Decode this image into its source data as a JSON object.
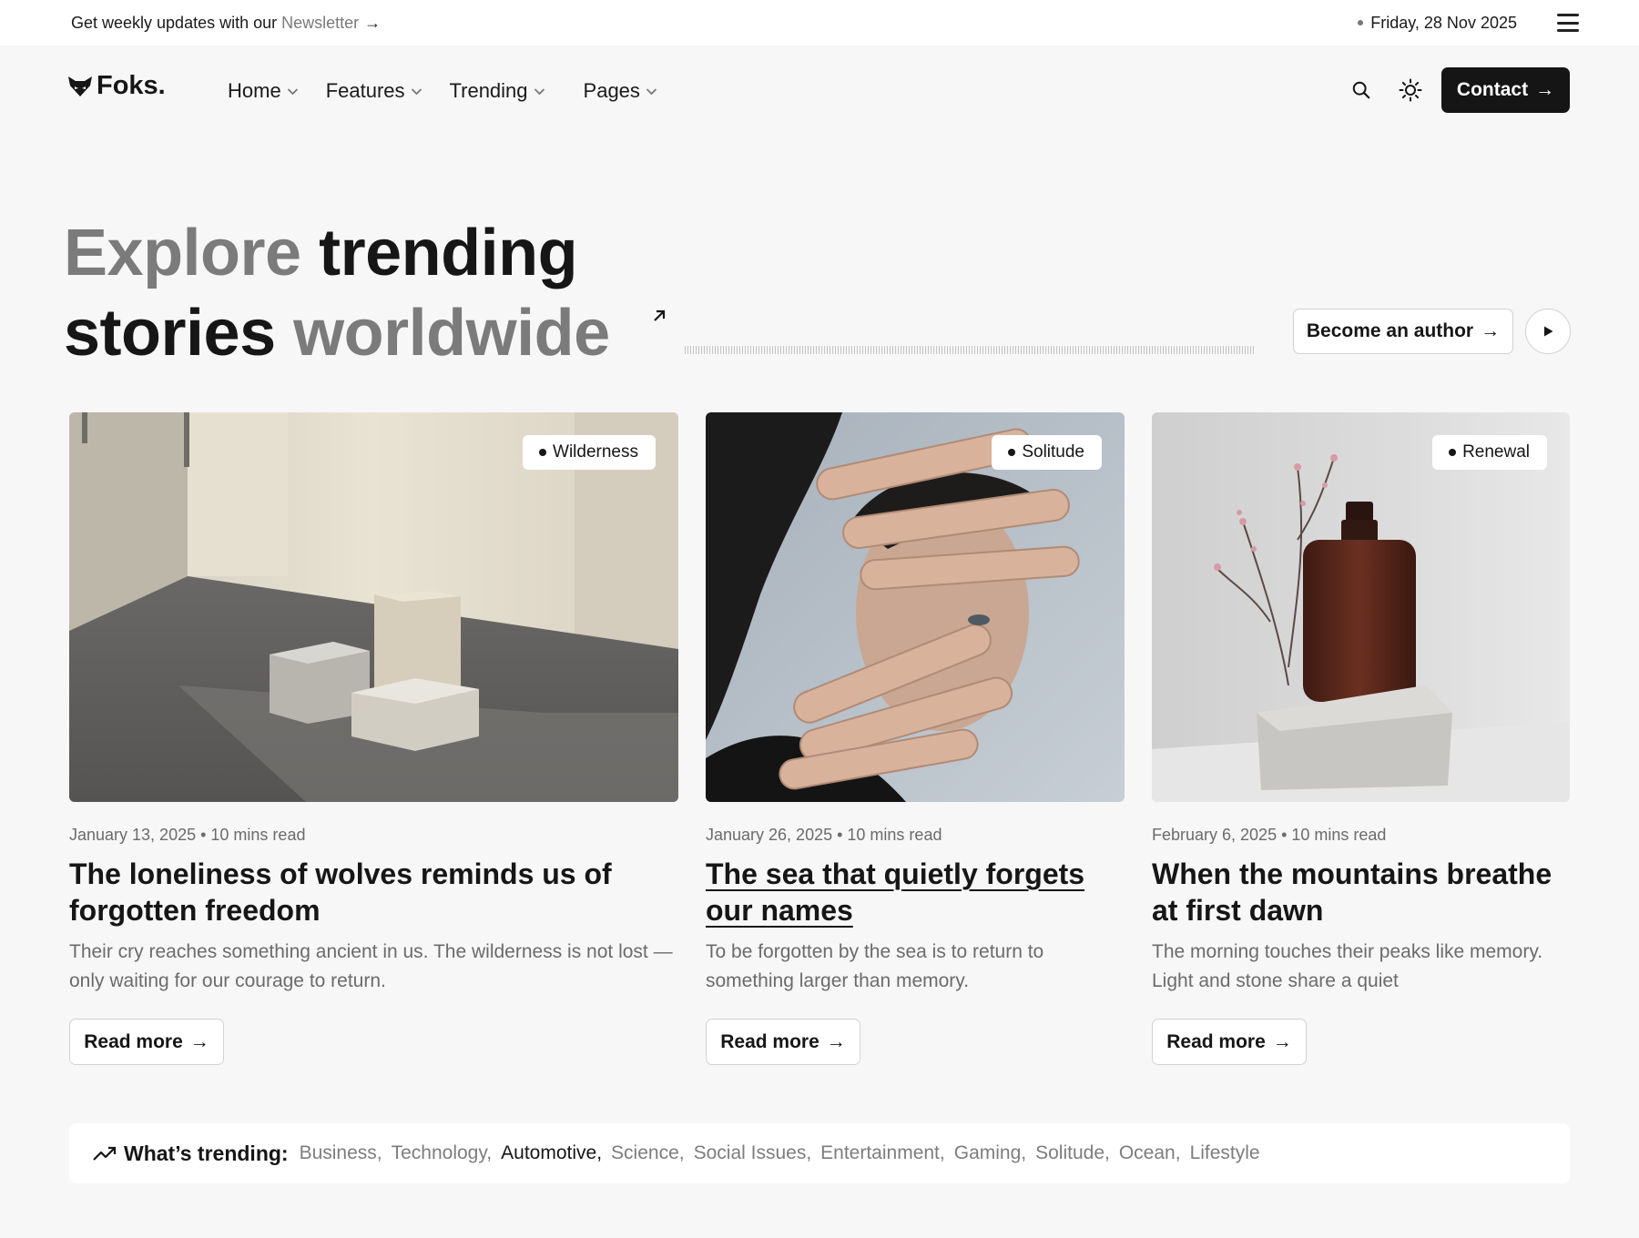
{
  "topbar": {
    "promo_text": "Get weekly updates with our",
    "newsletter_link": "Newsletter",
    "promo_arrow": "→",
    "date": "Friday, 28 Nov 2025"
  },
  "header": {
    "logo_text": "Foks.",
    "nav": [
      {
        "label": "Home"
      },
      {
        "label": "Features"
      },
      {
        "label": "Trending"
      },
      {
        "label": "Pages"
      }
    ],
    "contact_label": "Contact",
    "contact_arrow": "→"
  },
  "hero": {
    "line1_light": "Explore",
    "line1_dark": "trending",
    "line2_dark": "stories",
    "line2_light": "worldwide",
    "author_button": "Become an author",
    "author_arrow": "→"
  },
  "cards": [
    {
      "tag": "Wilderness",
      "meta": "January 13, 2025 • 10 mins read",
      "title": "The loneliness of wolves reminds us of forgotten freedom",
      "excerpt": "Their cry reaches something ancient in us. The wilderness is not lost — only waiting for our courage to return.",
      "button": "Read more",
      "arrow": "→"
    },
    {
      "tag": "Solitude",
      "meta": "January 26, 2025 • 10 mins read",
      "title": "The sea that quietly forgets our names",
      "excerpt": "To be forgotten by the sea is to return to something larger than memory.",
      "button": "Read more",
      "arrow": "→"
    },
    {
      "tag": "Renewal",
      "meta": "February 6, 2025 • 10 mins read",
      "title": "When the mountains breathe at first dawn",
      "excerpt": "The morning touches their peaks like memory. Light and stone share a quiet",
      "button": "Read more",
      "arrow": "→"
    }
  ],
  "trending": {
    "label": "What’s trending:",
    "topics": [
      "Business,",
      "Technology,",
      "Automotive,",
      "Science,",
      "Social Issues,",
      "Entertainment,",
      "Gaming,",
      "Solitude,",
      "Ocean,",
      "Lifestyle"
    ],
    "active_topic": "Automotive,"
  },
  "colors": {
    "page_bg": "#f7f7f7",
    "ink": "#161616",
    "muted": "#6b6b6b",
    "accent_button": "#151515"
  },
  "icons": {
    "logo": "fox-head-icon",
    "search": "search-icon",
    "theme": "sun-icon",
    "menu": "hamburger-menu-icon",
    "play": "play-icon",
    "trending": "trending-up-icon"
  }
}
